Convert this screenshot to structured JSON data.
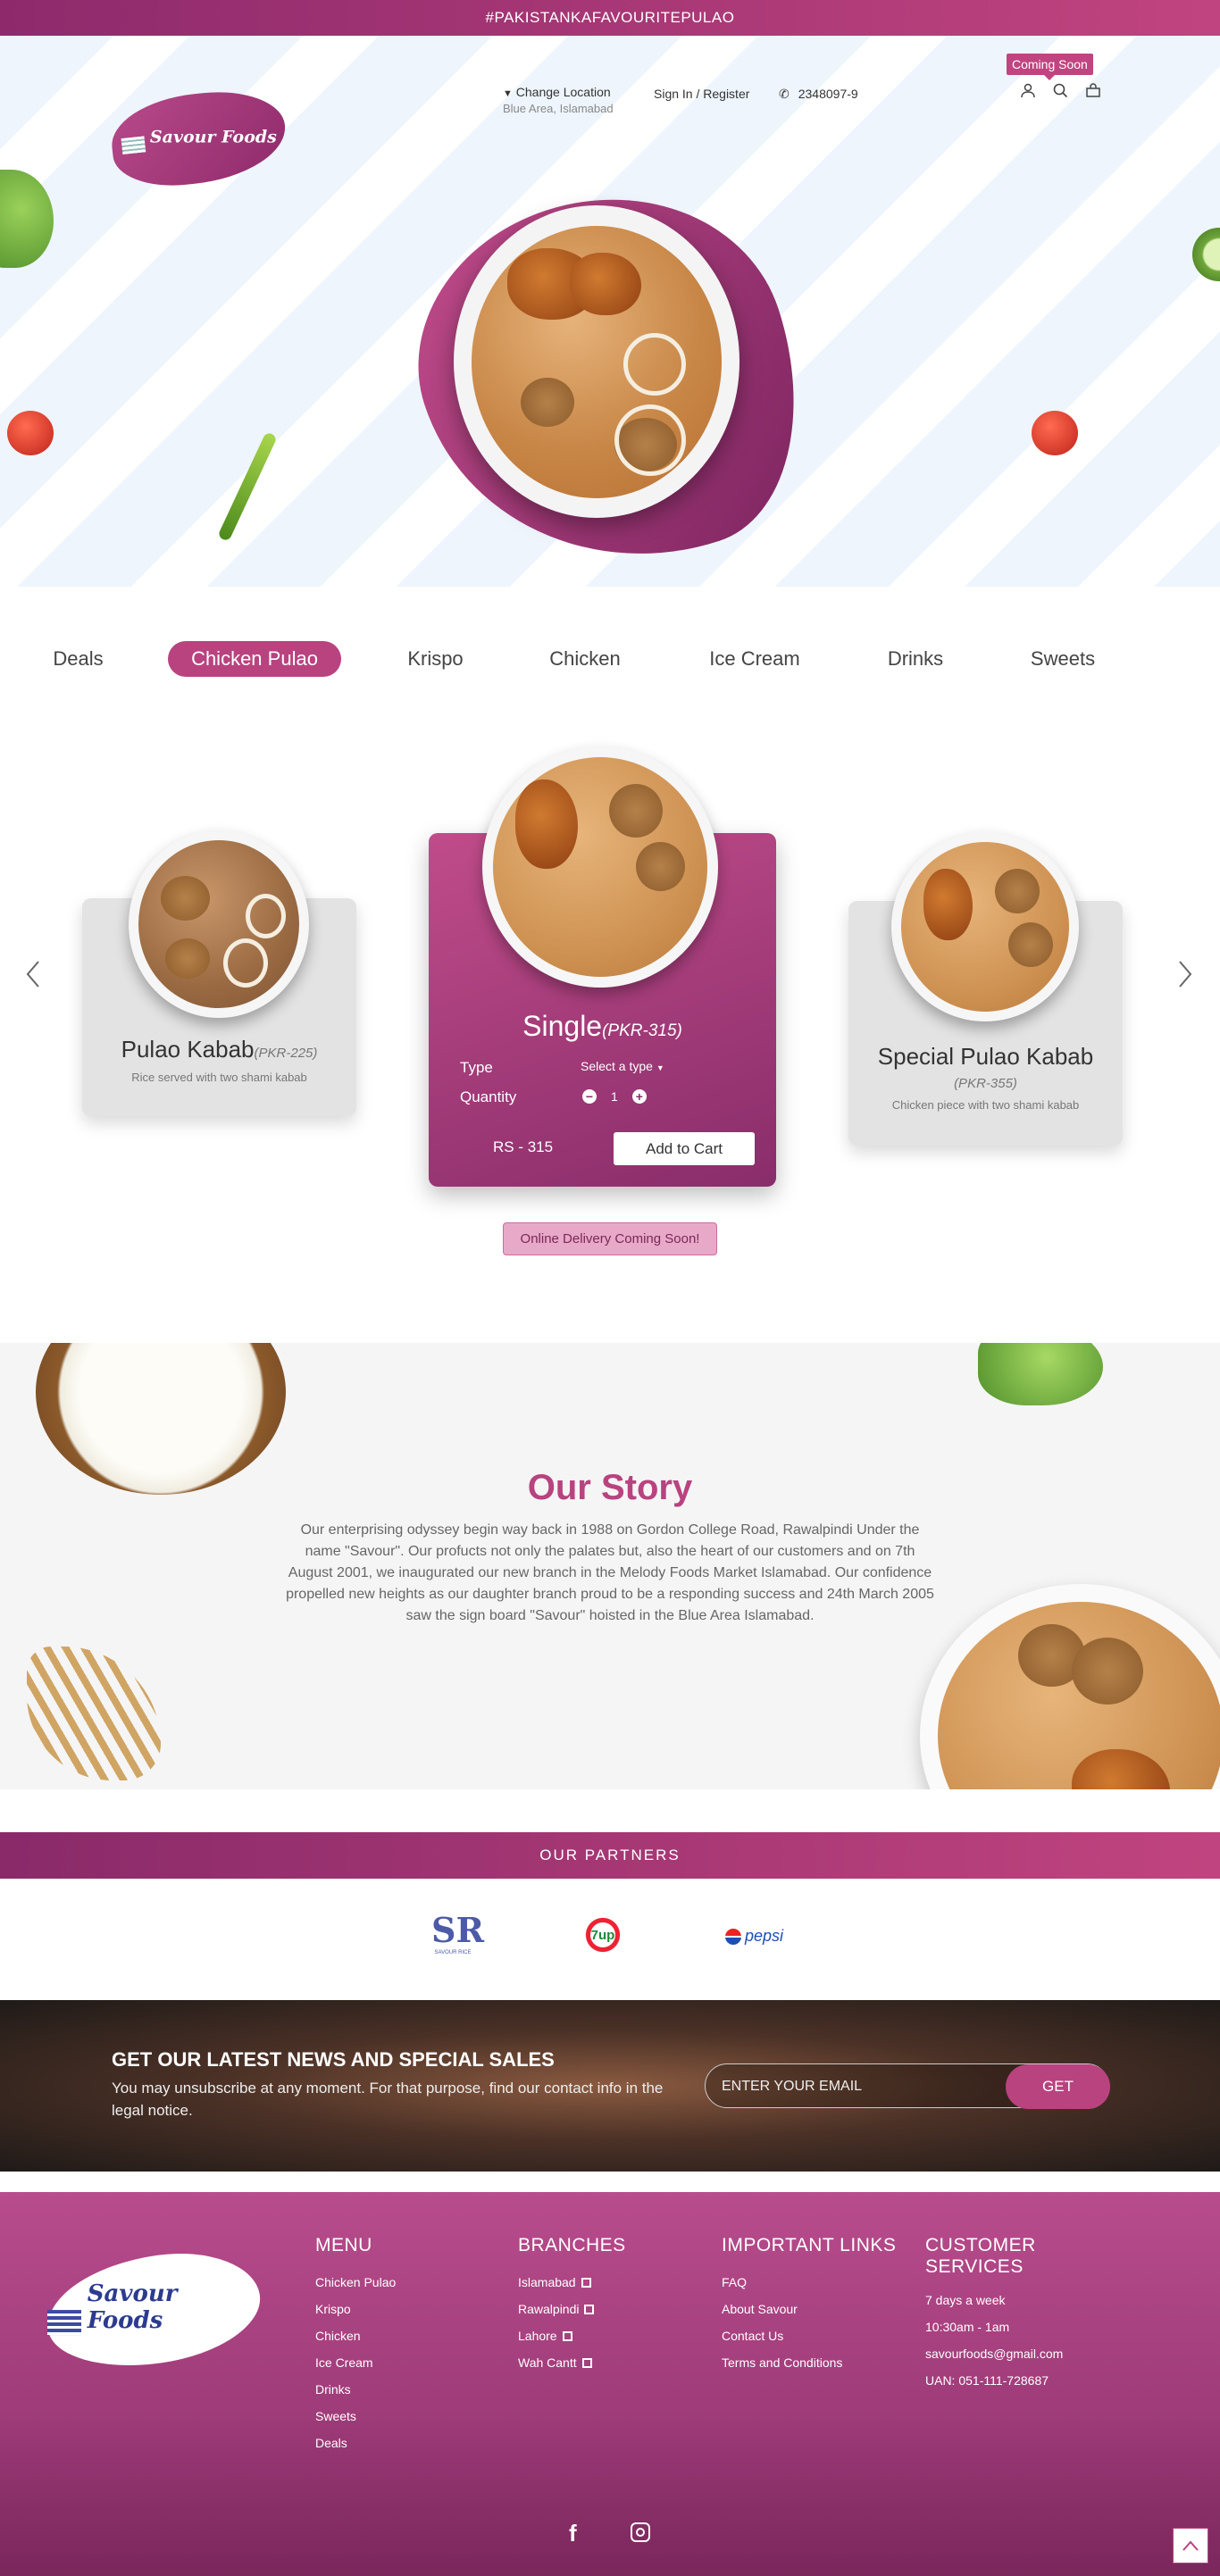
{
  "topbar": {
    "text": "#PAKISTANKAFAVOURITEPULAO"
  },
  "header": {
    "logo_text": "Savour Foods",
    "change_location": "Change Location",
    "location_value": "Blue Area, Islamabad",
    "signin": "Sign In / Register",
    "phone": "2348097-9",
    "coming_soon": "Coming Soon",
    "icons": [
      "user-icon",
      "search-icon",
      "cart-icon",
      "phone-icon",
      "chevron-down-icon"
    ]
  },
  "tabs": [
    {
      "label": "Deals"
    },
    {
      "label": "Chicken Pulao",
      "active": true
    },
    {
      "label": "Krispo"
    },
    {
      "label": "Chicken"
    },
    {
      "label": "Ice Cream"
    },
    {
      "label": "Drinks"
    },
    {
      "label": "Sweets"
    }
  ],
  "products": {
    "left": {
      "name": "Pulao Kabab",
      "price": "(PKR-225)",
      "desc": "Rice served with two shami kabab"
    },
    "center": {
      "name": "Single",
      "price": "(PKR-315)",
      "type_label": "Type",
      "type_select": "Select a type",
      "qty_label": "Quantity",
      "qty_value": "1",
      "total": "RS - 315",
      "add_to_cart": "Add to Cart"
    },
    "right": {
      "name": "Special Pulao Kabab",
      "price": "(PKR-355)",
      "desc": "Chicken piece with two shami kabab"
    },
    "prev_icon": "chevron-left-icon",
    "next_icon": "chevron-right-icon"
  },
  "delivery_notice": "Online Delivery Coming Soon!",
  "story": {
    "title": "Our Story",
    "text": "Our enterprising odyssey begin way back in 1988 on Gordon College Road, Rawalpindi Under the name \"Savour\". Our profucts not only the palates but, also the heart of our customers and on 7th August 2001, we inaugurated our new branch in the Melody Foods Market Islamabad. Our confidence propelled new heights as our daughter branch proud to be a responding success and 24th March 2005 saw the sign board \"Savour\" hoisted in the Blue Area Islamabad."
  },
  "partners": {
    "title": "OUR PARTNERS",
    "logos": [
      "SR",
      "7up",
      "pepsi"
    ],
    "sr_caption": "SAVOUR RICE"
  },
  "newsletter": {
    "title": "GET OUR LATEST NEWS AND SPECIAL SALES",
    "text": "You may unsubscribe at any moment. For that purpose, find our contact info in the legal notice.",
    "placeholder": "ENTER YOUR EMAIL",
    "button": "GET"
  },
  "footer": {
    "logo_text": "Savour Foods",
    "menu": {
      "title": "MENU",
      "items": [
        "Chicken Pulao",
        "Krispo",
        "Chicken",
        "Ice Cream",
        "Drinks",
        "Sweets",
        "Deals"
      ]
    },
    "branches": {
      "title": "BRANCHES",
      "items": [
        "Islamabad",
        "Rawalpindi",
        "Lahore",
        "Wah Cantt"
      ]
    },
    "links": {
      "title": "IMPORTANT LINKS",
      "items": [
        "FAQ",
        "About Savour",
        "Contact Us",
        "Terms and Conditions"
      ]
    },
    "customer": {
      "title": "CUSTOMER SERVICES",
      "items": [
        "7 days a week",
        "10:30am - 1am",
        "savourfoods@gmail.com",
        "UAN: 051-111-728687"
      ]
    },
    "social": [
      "facebook-icon",
      "instagram-icon"
    ]
  },
  "colors": {
    "brand": "#b8437f",
    "brand_dark": "#892d6a"
  }
}
